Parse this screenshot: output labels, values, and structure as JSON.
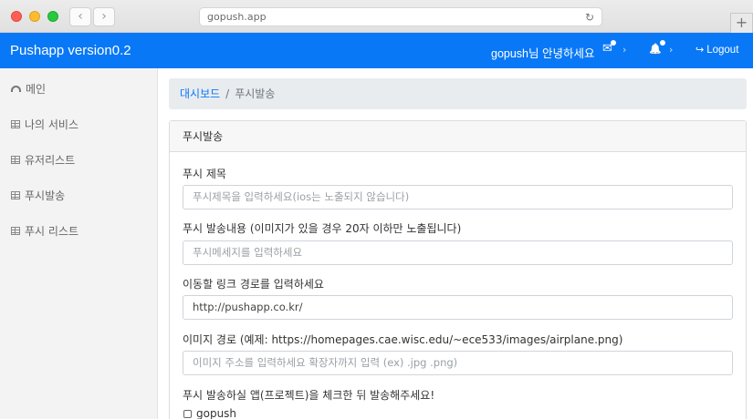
{
  "browser": {
    "url": "gopush.app",
    "back_glyph": "‹",
    "forward_glyph": "›",
    "reload_glyph": "↻",
    "newtab_glyph": "+"
  },
  "navbar": {
    "brand": "Pushapp version0.2",
    "greeting": "gopush님 안녕하세요",
    "mail_icon": "✉",
    "bell_icon": "🔔",
    "caret": "›",
    "logout_icon": "↪",
    "logout_label": "Logout",
    "color": "#0878f7"
  },
  "sidebar": {
    "items": [
      {
        "label": "메인",
        "icon": "gauge-icon"
      },
      {
        "label": "나의 서비스",
        "icon": "table-icon"
      },
      {
        "label": "유저리스트",
        "icon": "table-icon"
      },
      {
        "label": "푸시발송",
        "icon": "table-icon"
      },
      {
        "label": "푸시 리스트",
        "icon": "table-icon"
      }
    ]
  },
  "breadcrumb": {
    "home": "대시보드",
    "separator": "/",
    "current": "푸시발송"
  },
  "card": {
    "title": "푸시발송"
  },
  "form": {
    "title_label": "푸시 제목",
    "title_placeholder": "푸시제목을 입력하세요(ios는 노출되지 않습니다)",
    "message_label": "푸시 발송내용 (이미지가 있을 경우 20자 이하만 노출됩니다)",
    "message_placeholder": "푸시메세지를 입력하세요",
    "link_label": "이동할 링크 경로를 입력하세요",
    "link_value": "http://pushapp.co.kr/",
    "image_label": "이미지 경로 (예제: https://homepages.cae.wisc.edu/~ece533/images/airplane.png)",
    "image_placeholder": "이미지 주소를 입력하세요 확장자까지 입력 (ex) .jpg .png)",
    "apps_label": "푸시 발송하실 앱(프로젝트)을 체크한 뒤 발송해주세요!",
    "apps": [
      {
        "label": "gopush",
        "checked": false
      }
    ]
  }
}
